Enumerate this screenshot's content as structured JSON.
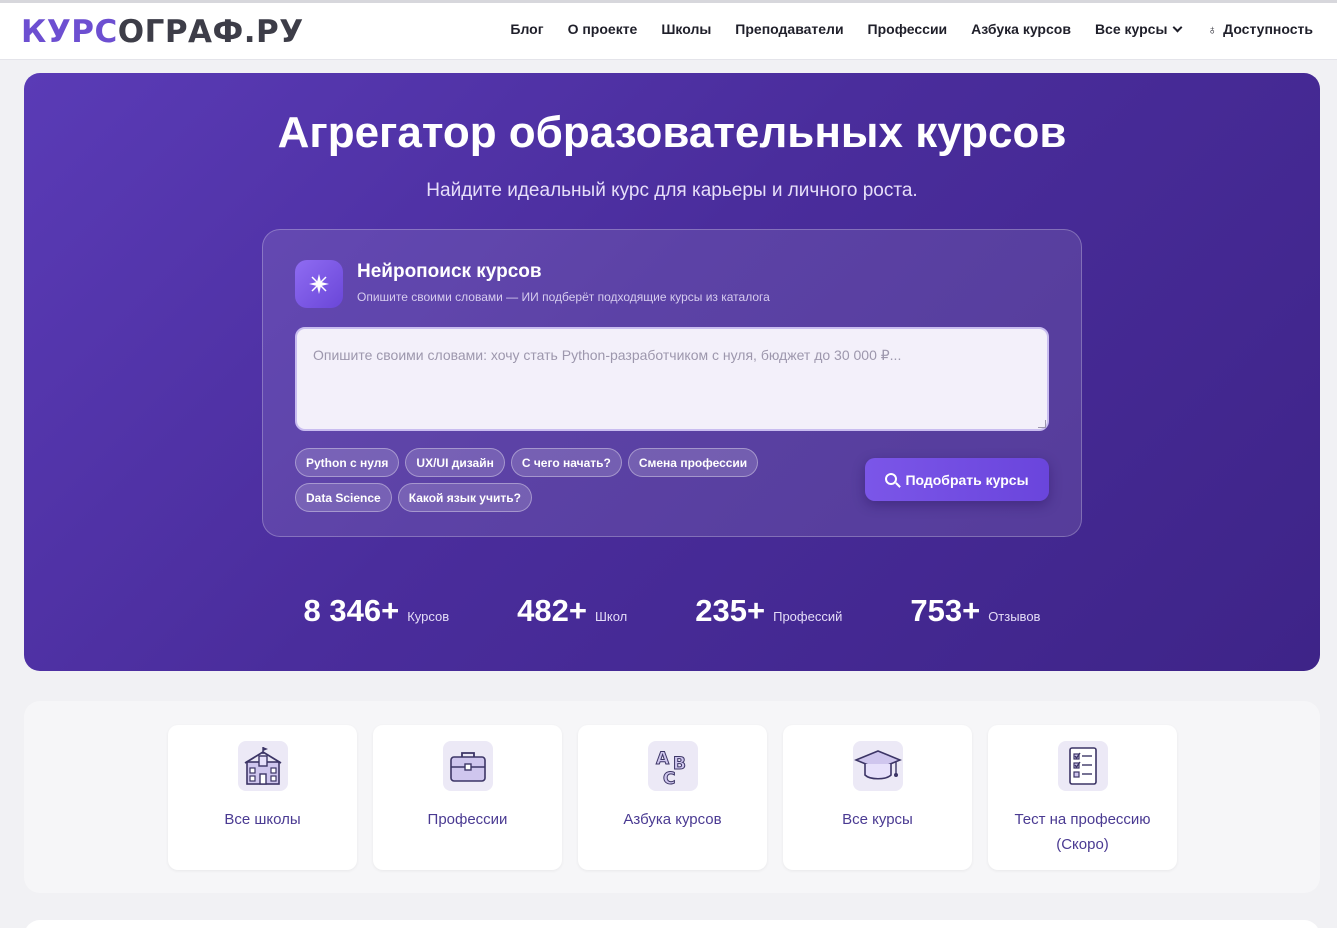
{
  "header": {
    "logo_part1": "КУРС",
    "logo_part2": "ОГРАФ.РУ",
    "nav": [
      {
        "label": "Блог"
      },
      {
        "label": "О проекте"
      },
      {
        "label": "Школы"
      },
      {
        "label": "Преподаватели"
      },
      {
        "label": "Профессии"
      },
      {
        "label": "Азбука курсов"
      },
      {
        "label": "Все курсы",
        "icon": "chevron-down-icon"
      },
      {
        "label": "Доступность",
        "icon": "accessibility-icon"
      }
    ]
  },
  "hero": {
    "title": "Агрегатор образовательных курсов",
    "subtitle": "Найдите идеальный курс для карьеры и личного роста.",
    "ai_search": {
      "icon": "sparkle-icon",
      "title": "Нейропоиск курсов",
      "description": "Опишите своими словами — ИИ подберёт подходящие курсы из каталога",
      "placeholder": "Опишите своими словами: хочу стать Python-разработчиком с нуля, бюджет до 30 000 ₽...",
      "value": "",
      "chips": [
        "Python с нуля",
        "UX/UI дизайн",
        "С чего начать?",
        "Смена профессии",
        "Data Science",
        "Какой язык учить?"
      ],
      "button_label": "Подобрать курсы",
      "button_icon": "search-icon"
    },
    "stats": [
      {
        "value": "8 346+",
        "label": "Курсов"
      },
      {
        "value": "482+",
        "label": "Школ"
      },
      {
        "value": "235+",
        "label": "Профессий"
      },
      {
        "value": "753+",
        "label": "Отзывов"
      }
    ]
  },
  "quick_links": [
    {
      "label": "Все школы",
      "icon": "school-building-icon"
    },
    {
      "label": "Профессии",
      "icon": "briefcase-icon"
    },
    {
      "label": "Азбука курсов",
      "icon": "abc-letters-icon"
    },
    {
      "label": "Все курсы",
      "icon": "graduation-cap-icon"
    },
    {
      "label": "Тест на профессию (Скоро)",
      "icon": "checklist-icon"
    }
  ],
  "colors": {
    "accent": "#6d4fd1",
    "hero_bg": "#4a2d9c",
    "link_text": "#4a3a92"
  }
}
